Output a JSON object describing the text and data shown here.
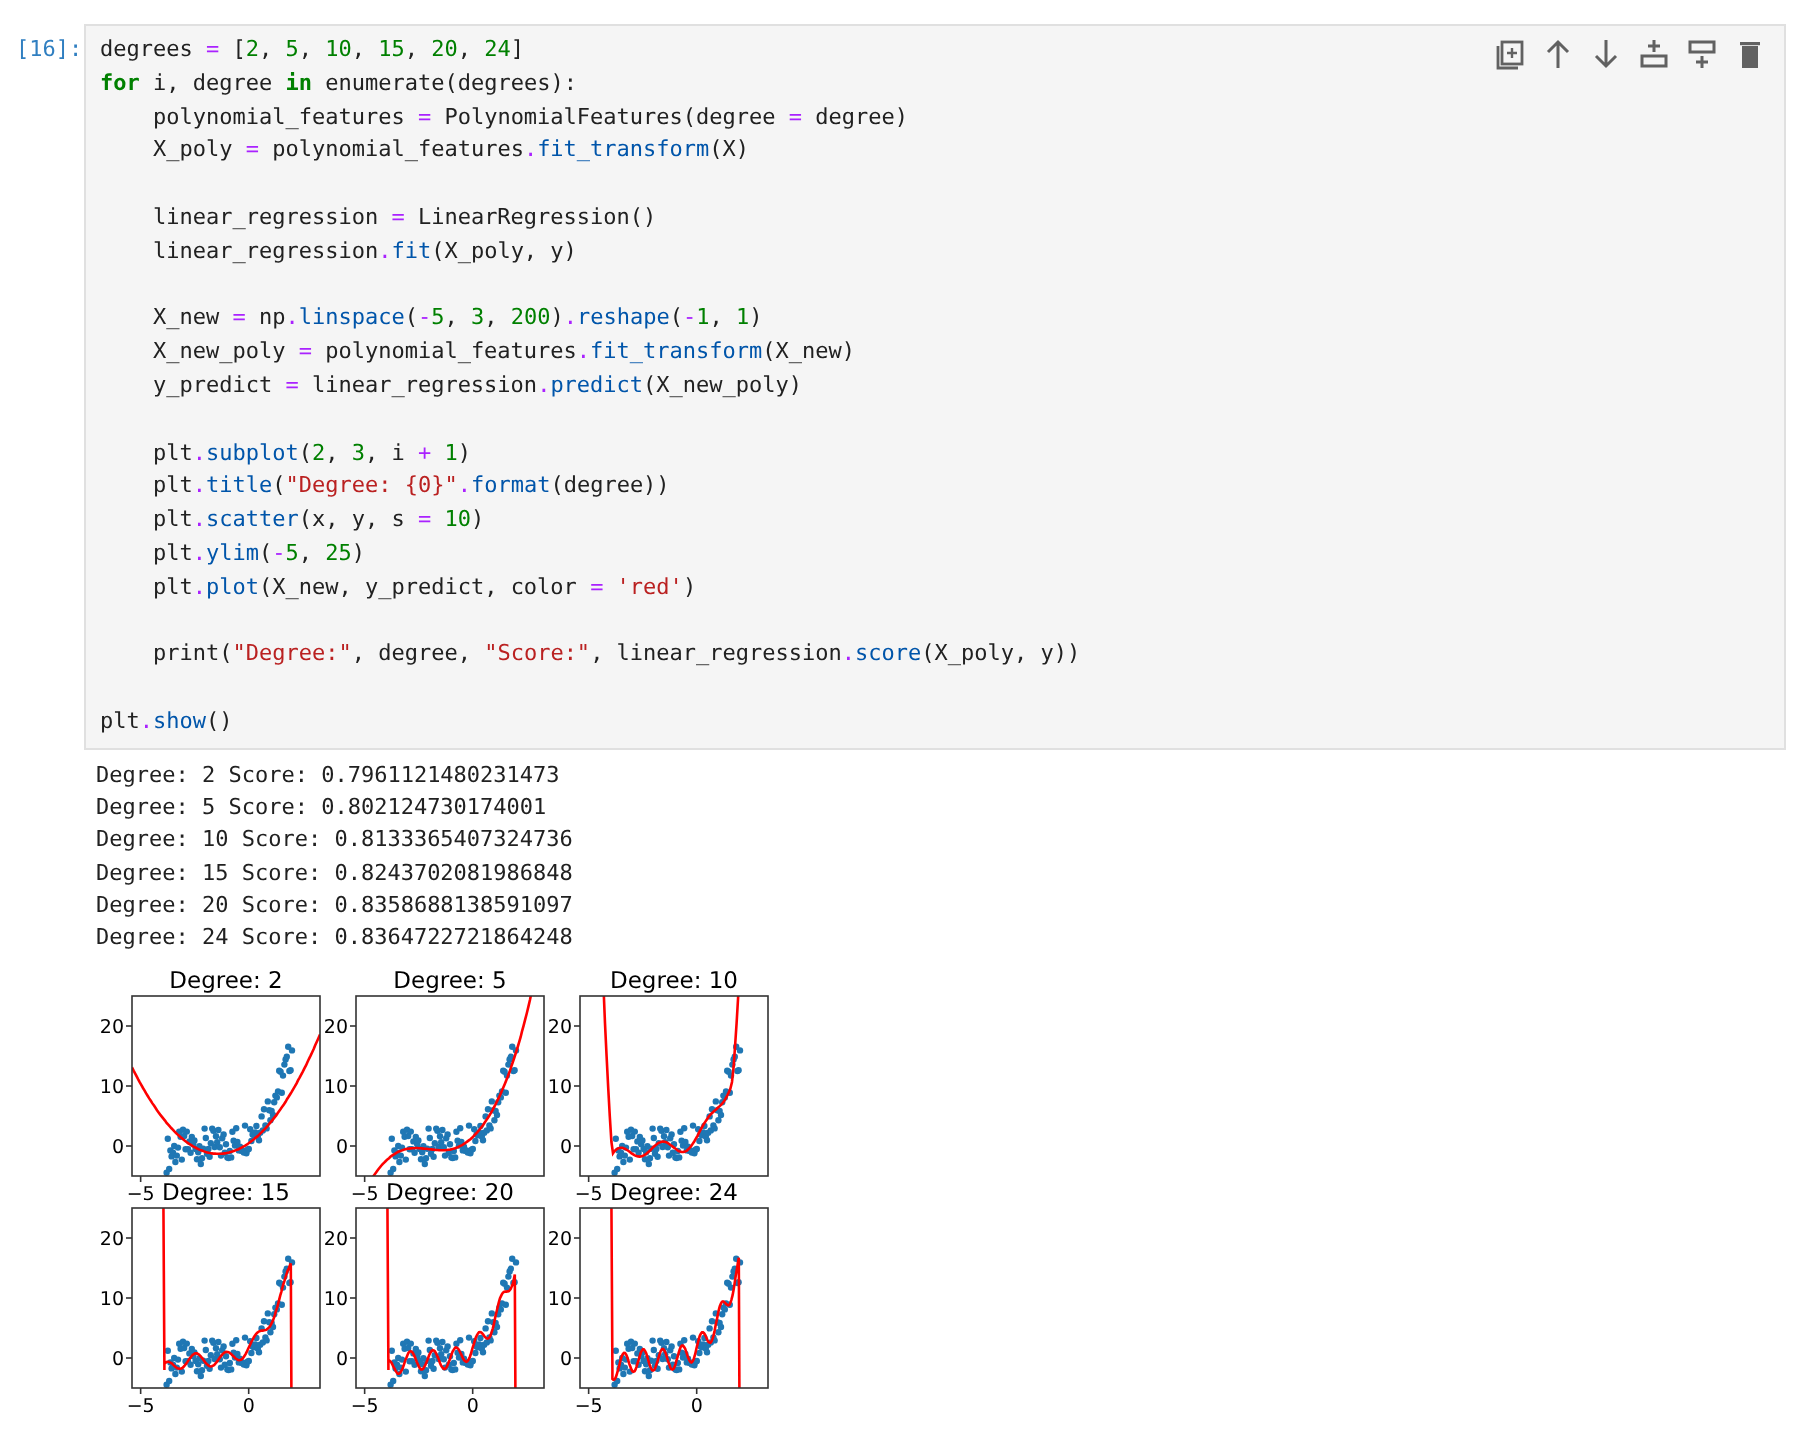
{
  "cell": {
    "prompt": "[16]:",
    "toolbar": [
      {
        "kind": "duplicate"
      },
      {
        "kind": "move-up"
      },
      {
        "kind": "move-down"
      },
      {
        "kind": "insert-above"
      },
      {
        "kind": "insert-below"
      },
      {
        "kind": "delete"
      }
    ],
    "code": [
      {
        "kind": "code",
        "tokens": [
          {
            "kind": "name",
            "text": "degrees "
          },
          {
            "kind": "op",
            "text": "="
          },
          {
            "kind": "name",
            "text": " ["
          },
          {
            "kind": "num",
            "text": "2"
          },
          {
            "kind": "name",
            "text": ", "
          },
          {
            "kind": "num",
            "text": "5"
          },
          {
            "kind": "name",
            "text": ", "
          },
          {
            "kind": "num",
            "text": "10"
          },
          {
            "kind": "name",
            "text": ", "
          },
          {
            "kind": "num",
            "text": "15"
          },
          {
            "kind": "name",
            "text": ", "
          },
          {
            "kind": "num",
            "text": "20"
          },
          {
            "kind": "name",
            "text": ", "
          },
          {
            "kind": "num",
            "text": "24"
          },
          {
            "kind": "name",
            "text": "]"
          }
        ]
      },
      {
        "kind": "code",
        "tokens": [
          {
            "kind": "keyword",
            "text": "for"
          },
          {
            "kind": "name",
            "text": " i, degree "
          },
          {
            "kind": "keyword",
            "text": "in"
          },
          {
            "kind": "name",
            "text": " enumerate(degrees):"
          }
        ]
      },
      {
        "kind": "code",
        "tokens": [
          {
            "kind": "name",
            "text": "    polynomial_features "
          },
          {
            "kind": "op",
            "text": "="
          },
          {
            "kind": "name",
            "text": " PolynomialFeatures(degree "
          },
          {
            "kind": "op",
            "text": "="
          },
          {
            "kind": "name",
            "text": " degree)"
          }
        ]
      },
      {
        "kind": "code",
        "tokens": [
          {
            "kind": "name",
            "text": "    X_poly "
          },
          {
            "kind": "op",
            "text": "="
          },
          {
            "kind": "name",
            "text": " polynomial_features"
          },
          {
            "kind": "op",
            "text": "."
          },
          {
            "kind": "attr",
            "text": "fit_transform"
          },
          {
            "kind": "name",
            "text": "(X)"
          }
        ]
      },
      {
        "kind": "blank"
      },
      {
        "kind": "code",
        "tokens": [
          {
            "kind": "name",
            "text": "    linear_regression "
          },
          {
            "kind": "op",
            "text": "="
          },
          {
            "kind": "name",
            "text": " LinearRegression()"
          }
        ]
      },
      {
        "kind": "code",
        "tokens": [
          {
            "kind": "name",
            "text": "    linear_regression"
          },
          {
            "kind": "op",
            "text": "."
          },
          {
            "kind": "attr",
            "text": "fit"
          },
          {
            "kind": "name",
            "text": "(X_poly, y)"
          }
        ]
      },
      {
        "kind": "blank"
      },
      {
        "kind": "code",
        "tokens": [
          {
            "kind": "name",
            "text": "    X_new "
          },
          {
            "kind": "op",
            "text": "="
          },
          {
            "kind": "name",
            "text": " np"
          },
          {
            "kind": "op",
            "text": "."
          },
          {
            "kind": "attr",
            "text": "linspace"
          },
          {
            "kind": "name",
            "text": "("
          },
          {
            "kind": "op",
            "text": "-"
          },
          {
            "kind": "num",
            "text": "5"
          },
          {
            "kind": "name",
            "text": ", "
          },
          {
            "kind": "num",
            "text": "3"
          },
          {
            "kind": "name",
            "text": ", "
          },
          {
            "kind": "num",
            "text": "200"
          },
          {
            "kind": "name",
            "text": ")"
          },
          {
            "kind": "op",
            "text": "."
          },
          {
            "kind": "attr",
            "text": "reshape"
          },
          {
            "kind": "name",
            "text": "("
          },
          {
            "kind": "op",
            "text": "-"
          },
          {
            "kind": "num",
            "text": "1"
          },
          {
            "kind": "name",
            "text": ", "
          },
          {
            "kind": "num",
            "text": "1"
          },
          {
            "kind": "name",
            "text": ")"
          }
        ]
      },
      {
        "kind": "code",
        "tokens": [
          {
            "kind": "name",
            "text": "    X_new_poly "
          },
          {
            "kind": "op",
            "text": "="
          },
          {
            "kind": "name",
            "text": " polynomial_features"
          },
          {
            "kind": "op",
            "text": "."
          },
          {
            "kind": "attr",
            "text": "fit_transform"
          },
          {
            "kind": "name",
            "text": "(X_new)"
          }
        ]
      },
      {
        "kind": "code",
        "tokens": [
          {
            "kind": "name",
            "text": "    y_predict "
          },
          {
            "kind": "op",
            "text": "="
          },
          {
            "kind": "name",
            "text": " linear_regression"
          },
          {
            "kind": "op",
            "text": "."
          },
          {
            "kind": "attr",
            "text": "predict"
          },
          {
            "kind": "name",
            "text": "(X_new_poly)"
          }
        ]
      },
      {
        "kind": "blank"
      },
      {
        "kind": "code",
        "tokens": [
          {
            "kind": "name",
            "text": "    plt"
          },
          {
            "kind": "op",
            "text": "."
          },
          {
            "kind": "attr",
            "text": "subplot"
          },
          {
            "kind": "name",
            "text": "("
          },
          {
            "kind": "num",
            "text": "2"
          },
          {
            "kind": "name",
            "text": ", "
          },
          {
            "kind": "num",
            "text": "3"
          },
          {
            "kind": "name",
            "text": ", i "
          },
          {
            "kind": "op",
            "text": "+"
          },
          {
            "kind": "num",
            "text": " 1"
          },
          {
            "kind": "name",
            "text": ")"
          }
        ]
      },
      {
        "kind": "code",
        "tokens": [
          {
            "kind": "name",
            "text": "    plt"
          },
          {
            "kind": "op",
            "text": "."
          },
          {
            "kind": "attr",
            "text": "title"
          },
          {
            "kind": "name",
            "text": "("
          },
          {
            "kind": "str",
            "text": "\"Degree: {0}\""
          },
          {
            "kind": "op",
            "text": "."
          },
          {
            "kind": "attr",
            "text": "format"
          },
          {
            "kind": "name",
            "text": "(degree))"
          }
        ]
      },
      {
        "kind": "code",
        "tokens": [
          {
            "kind": "name",
            "text": "    plt"
          },
          {
            "kind": "op",
            "text": "."
          },
          {
            "kind": "attr",
            "text": "scatter"
          },
          {
            "kind": "name",
            "text": "(x, y, s "
          },
          {
            "kind": "op",
            "text": "="
          },
          {
            "kind": "num",
            "text": " 10"
          },
          {
            "kind": "name",
            "text": ")"
          }
        ]
      },
      {
        "kind": "code",
        "tokens": [
          {
            "kind": "name",
            "text": "    plt"
          },
          {
            "kind": "op",
            "text": "."
          },
          {
            "kind": "attr",
            "text": "ylim"
          },
          {
            "kind": "name",
            "text": "("
          },
          {
            "kind": "op",
            "text": "-"
          },
          {
            "kind": "num",
            "text": "5"
          },
          {
            "kind": "name",
            "text": ", "
          },
          {
            "kind": "num",
            "text": "25"
          },
          {
            "kind": "name",
            "text": ")"
          }
        ]
      },
      {
        "kind": "code",
        "tokens": [
          {
            "kind": "name",
            "text": "    plt"
          },
          {
            "kind": "op",
            "text": "."
          },
          {
            "kind": "attr",
            "text": "plot"
          },
          {
            "kind": "name",
            "text": "(X_new, y_predict, color "
          },
          {
            "kind": "op",
            "text": "="
          },
          {
            "kind": "str",
            "text": " 'red'"
          },
          {
            "kind": "name",
            "text": ")"
          }
        ]
      },
      {
        "kind": "blank"
      },
      {
        "kind": "code",
        "tokens": [
          {
            "kind": "name",
            "text": "    print("
          },
          {
            "kind": "str",
            "text": "\"Degree:\""
          },
          {
            "kind": "name",
            "text": ", degree, "
          },
          {
            "kind": "str",
            "text": "\"Score:\""
          },
          {
            "kind": "name",
            "text": ", linear_regression"
          },
          {
            "kind": "op",
            "text": "."
          },
          {
            "kind": "attr",
            "text": "score"
          },
          {
            "kind": "name",
            "text": "(X_poly, y))"
          }
        ]
      },
      {
        "kind": "blank"
      },
      {
        "kind": "code",
        "tokens": [
          {
            "kind": "name",
            "text": "plt"
          },
          {
            "kind": "op",
            "text": "."
          },
          {
            "kind": "attr",
            "text": "show"
          },
          {
            "kind": "name",
            "text": "()"
          }
        ]
      }
    ],
    "output": [
      "Degree: 2 Score: 0.7961121480231473",
      "Degree: 5 Score: 0.802124730174001",
      "Degree: 10 Score: 0.8133365407324736",
      "Degree: 15 Score: 0.8243702081986848",
      "Degree: 20 Score: 0.8358688138591097",
      "Degree: 24 Score: 0.8364722721864248"
    ],
    "plots": [
      {
        "title": "Degree: 2",
        "yticks": [
          "20",
          "10",
          "0"
        ],
        "xticks": [
          "−5"
        ]
      },
      {
        "title": "Degree: 5",
        "yticks": [
          "20",
          "10",
          "0"
        ],
        "xticks": [
          "−5"
        ]
      },
      {
        "title": "Degree: 10",
        "yticks": [
          "20",
          "10",
          "0"
        ],
        "xticks": [
          "−5"
        ]
      },
      {
        "title": "Degree: 15",
        "yticks": [
          "20",
          "10",
          "0"
        ],
        "xticks": [
          "−5",
          "0"
        ]
      },
      {
        "title": "Degree: 20",
        "yticks": [
          "20",
          "10",
          "0"
        ],
        "xticks": [
          "−5",
          "0"
        ]
      },
      {
        "title": "Degree: 24",
        "yticks": [
          "20",
          "10",
          "0"
        ],
        "xticks": [
          "−5",
          "0"
        ]
      }
    ]
  }
}
